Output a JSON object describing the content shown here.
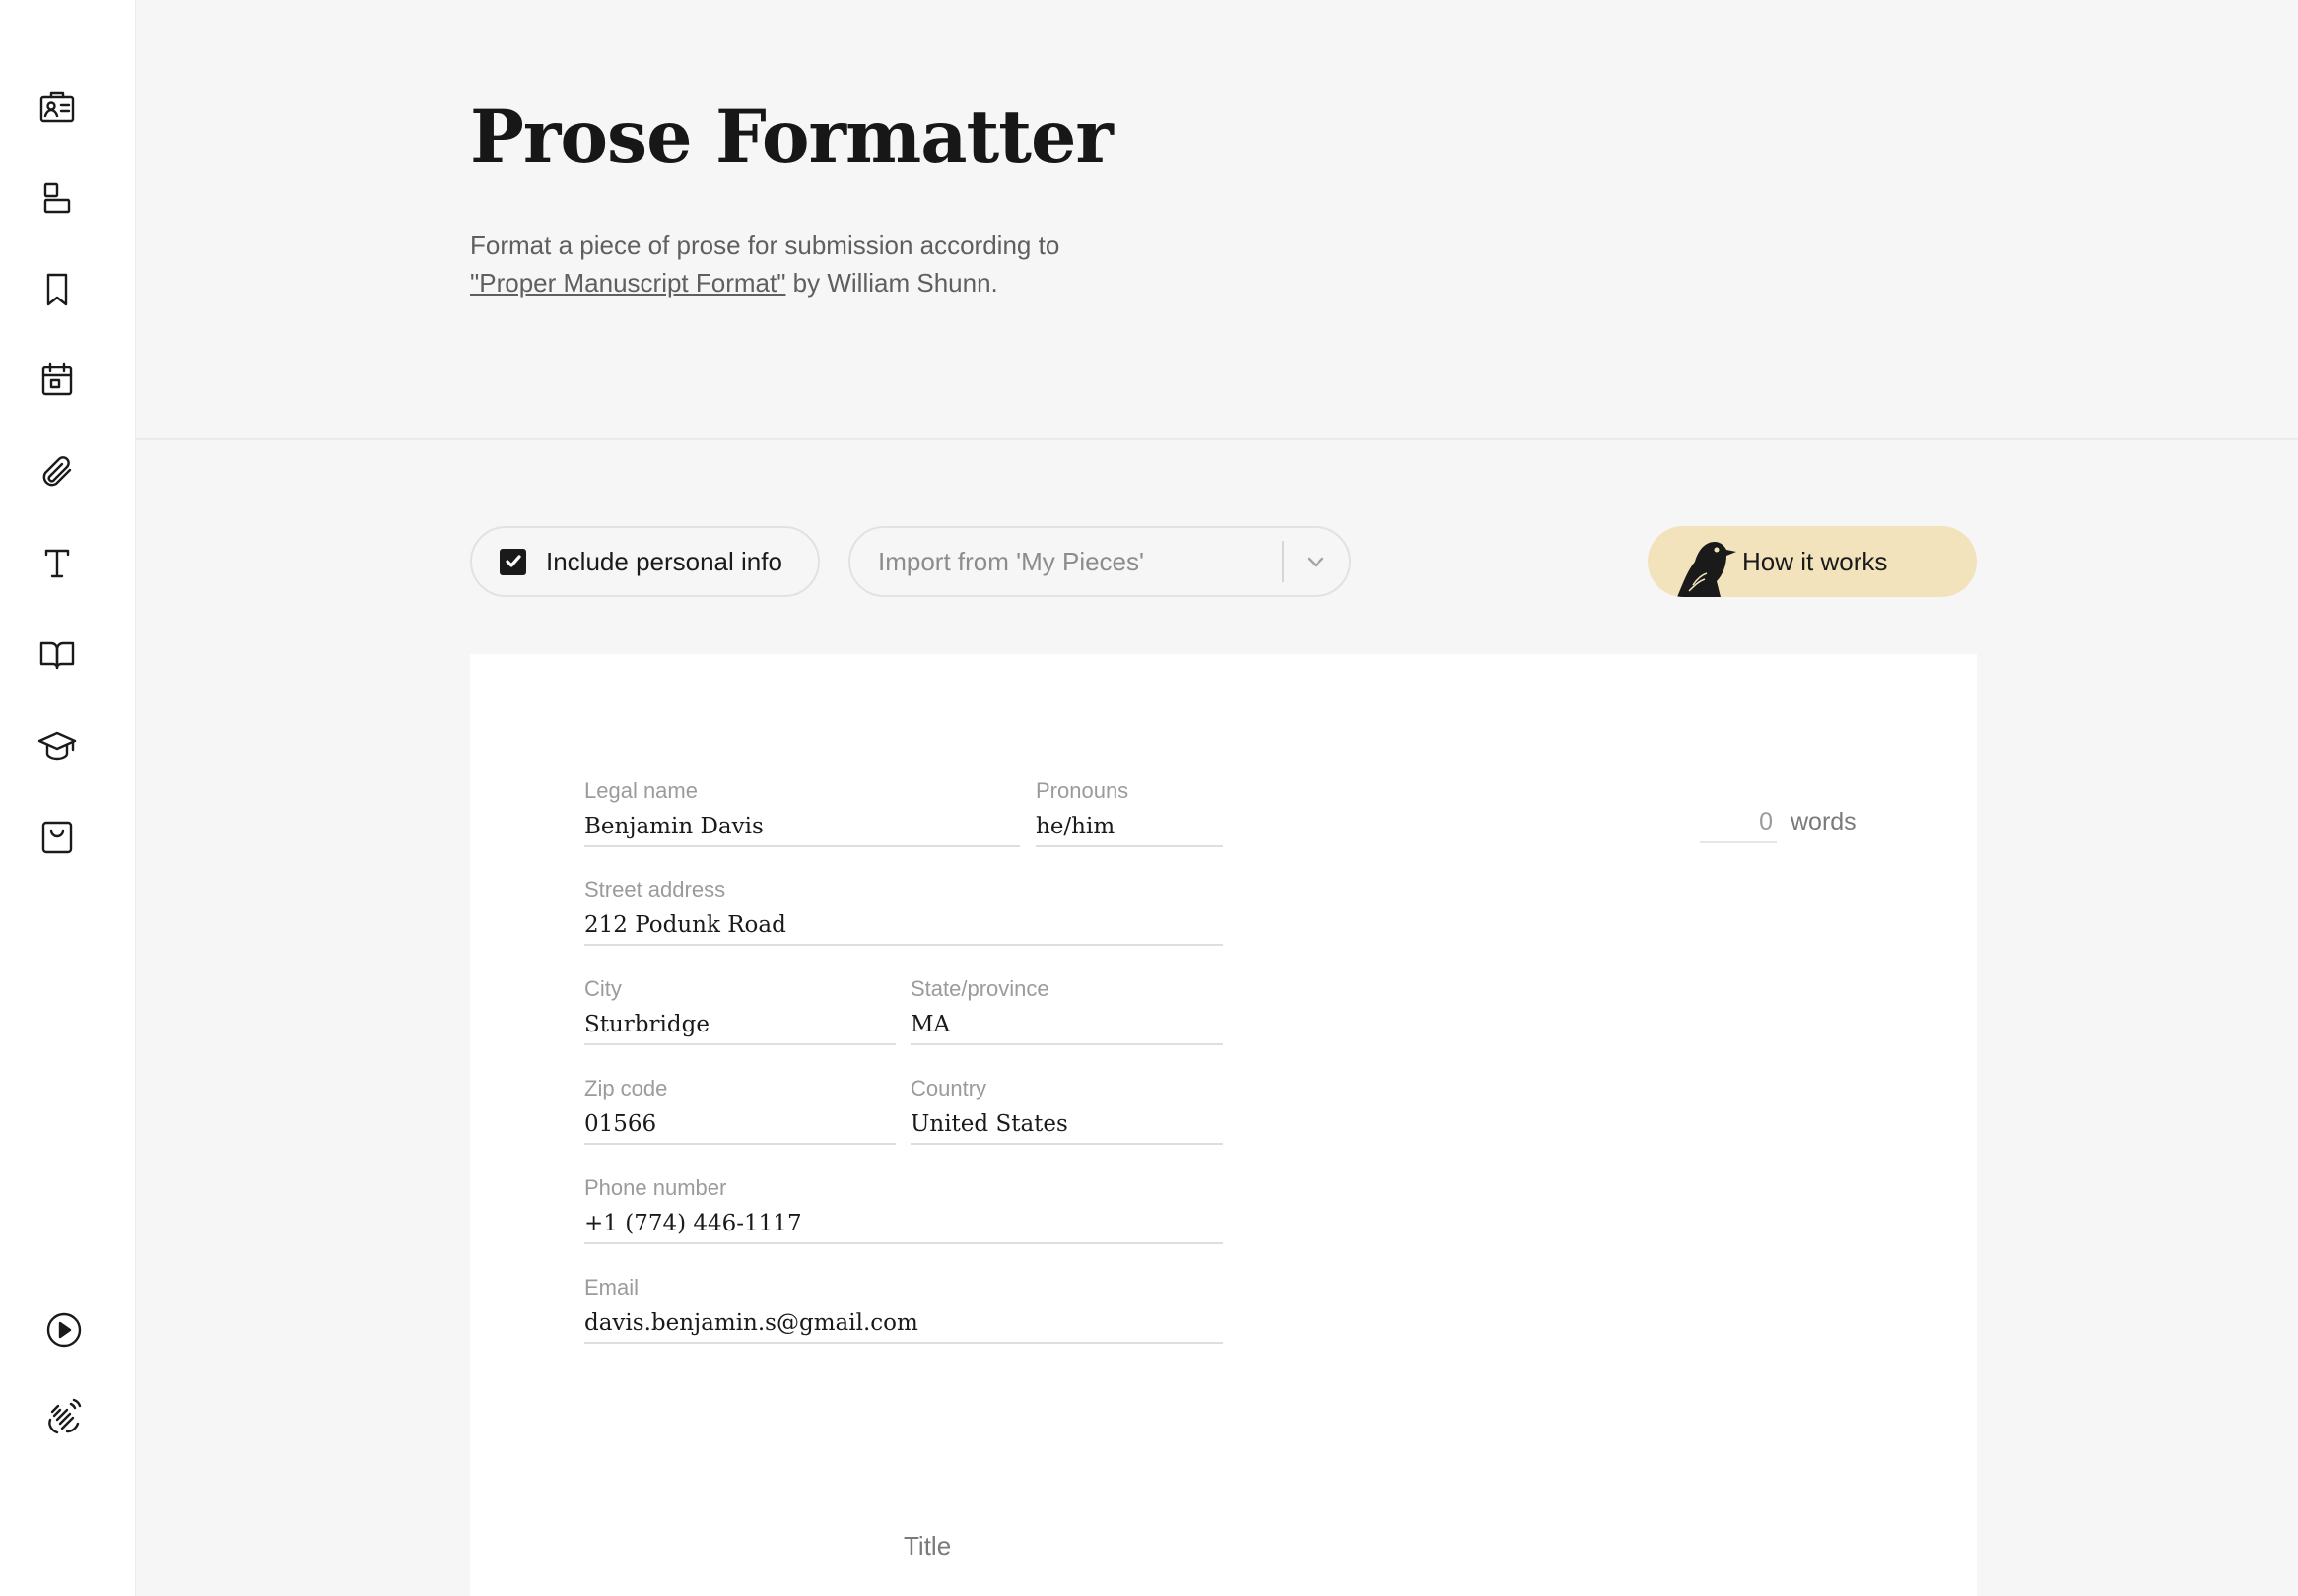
{
  "sidebar": {
    "icons": [
      "id-card-icon",
      "layout-icon",
      "bookmark-icon",
      "calendar-icon",
      "paperclip-icon",
      "text-icon",
      "book-open-icon",
      "graduation-cap-icon",
      "shopping-bag-icon",
      "play-circle-icon",
      "waving-hand-icon"
    ]
  },
  "header": {
    "title": "Prose Formatter",
    "subtitle_pre": "Format a piece of prose for submission according to ",
    "subtitle_link": "\"Proper Manuscript Format\"",
    "subtitle_post": " by William Shunn."
  },
  "toolbar": {
    "include_personal_info": "Include personal info",
    "include_checked": true,
    "import_placeholder": "Import from 'My Pieces'",
    "how_it_works": "How it works"
  },
  "form": {
    "legal_name": {
      "label": "Legal name",
      "value": "Benjamin Davis"
    },
    "pronouns": {
      "label": "Pronouns",
      "value": "he/him"
    },
    "street": {
      "label": "Street address",
      "value": "212 Podunk Road"
    },
    "city": {
      "label": "City",
      "value": "Sturbridge"
    },
    "state": {
      "label": "State/province",
      "value": "MA"
    },
    "zip": {
      "label": "Zip code",
      "value": "01566"
    },
    "country": {
      "label": "Country",
      "value": "United States"
    },
    "phone": {
      "label": "Phone number",
      "value": "+1 (774) 446-1117"
    },
    "email": {
      "label": "Email",
      "value": "davis.benjamin.s@gmail.com"
    }
  },
  "word_count": {
    "count": "0",
    "label": "words"
  },
  "document": {
    "title_placeholder": "Title"
  },
  "colors": {
    "accent_button": "#f2e3bc",
    "background": "#f6f6f6",
    "paper": "#ffffff"
  }
}
